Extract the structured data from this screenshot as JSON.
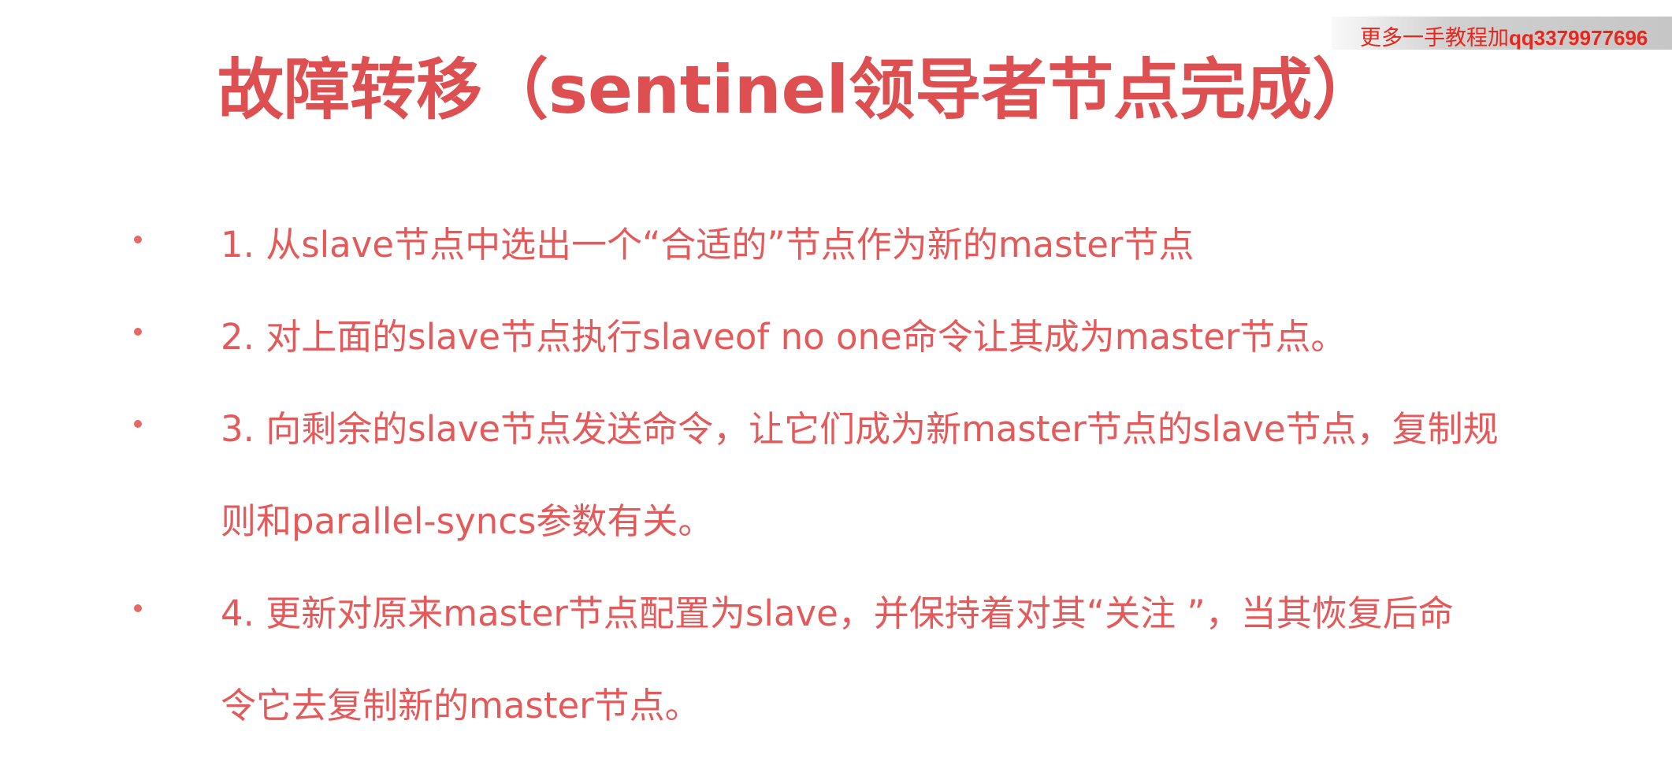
{
  "watermark": {
    "prefix": "更多一手教程加",
    "contact": "qq3379977696"
  },
  "slide": {
    "title": "故障转移（sentinel领导者节点完成）",
    "items": [
      {
        "text": "1. 从slave节点中选出一个“合适的”节点作为新的master节点"
      },
      {
        "text": "2. 对上面的slave节点执行slaveof no one命令让其成为master节点。"
      },
      {
        "text": "3. 向剩余的slave节点发送命令，让它们成为新master节点的slave节点，复制规\n则和parallel-syncs参数有关。"
      },
      {
        "text": "4. 更新对原来master节点配置为slave，并保持着对其“关注 ”，当其恢复后命\n令它去复制新的master节点。"
      }
    ]
  },
  "colors": {
    "title": "#dd4f50",
    "body_text": "#e45a5b",
    "watermark_text": "#e8261c"
  }
}
